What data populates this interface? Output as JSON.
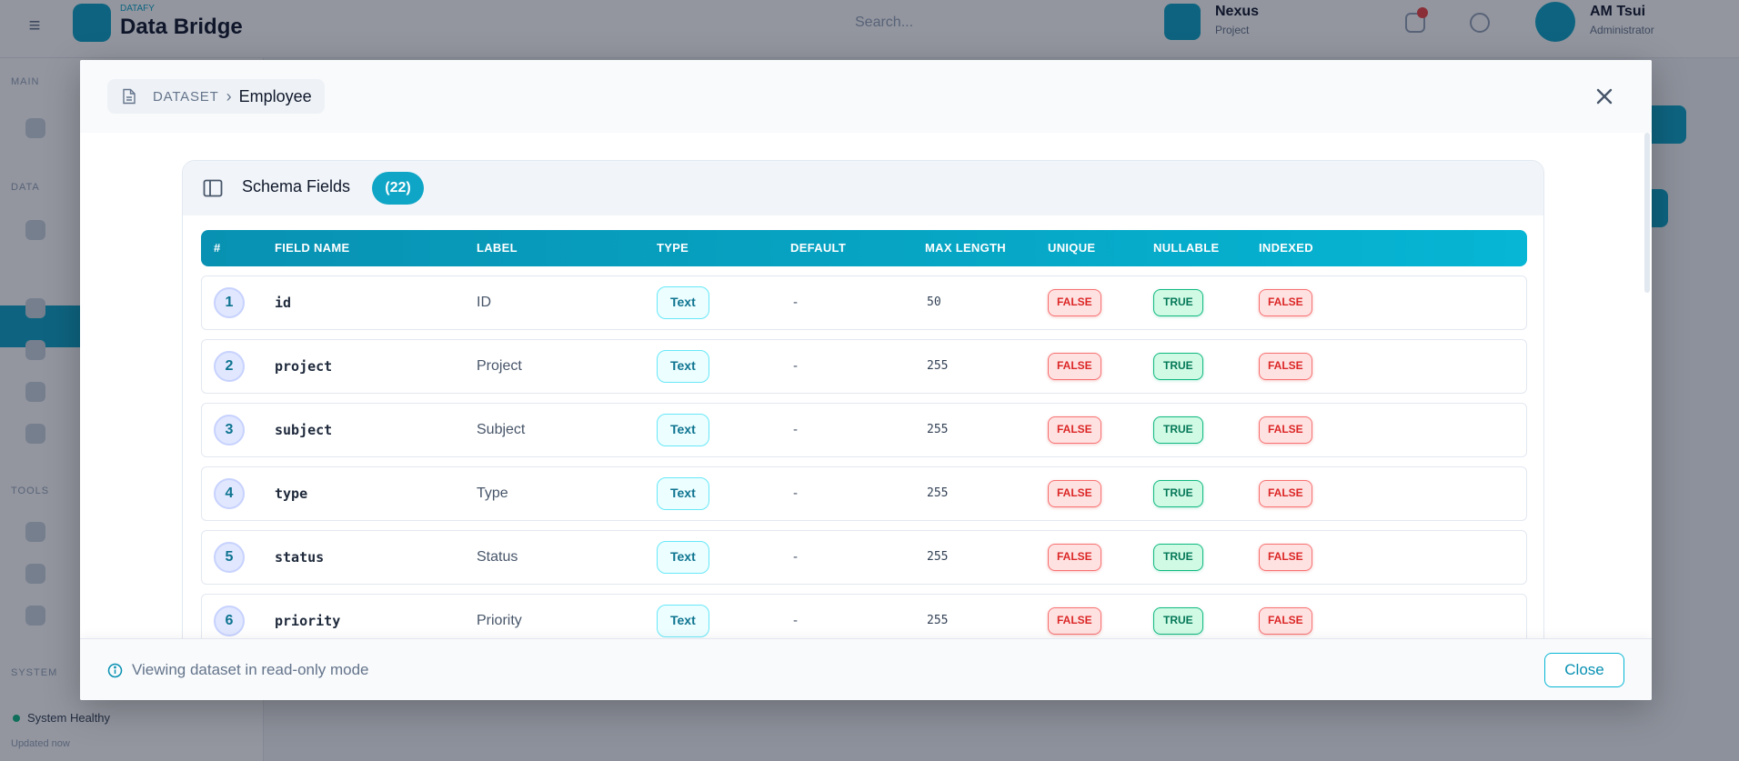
{
  "background": {
    "brand_sup": "DATAFY",
    "brand": "Data Bridge",
    "search_placeholder": "Search...",
    "workspace_name": "Nexus",
    "workspace_sub": "Project",
    "user_name": "AM Tsui",
    "user_role": "Administrator",
    "status_text": "System Healthy",
    "status_sub": "Updated now"
  },
  "modal": {
    "breadcrumb_root": "DATASET",
    "breadcrumb_separator": "›",
    "breadcrumb_current": "Employee",
    "card_title": "Schema Fields",
    "field_count": "(22)",
    "columns": [
      "#",
      "FIELD NAME",
      "LABEL",
      "TYPE",
      "DEFAULT",
      "MAX LENGTH",
      "UNIQUE",
      "NULLABLE",
      "INDEXED"
    ],
    "rows": [
      {
        "n": "1",
        "field": "id",
        "label": "ID",
        "type": "Text",
        "default": "-",
        "max": "50",
        "unique": "FALSE",
        "nullable": "TRUE",
        "indexed": "FALSE"
      },
      {
        "n": "2",
        "field": "project",
        "label": "Project",
        "type": "Text",
        "default": "-",
        "max": "255",
        "unique": "FALSE",
        "nullable": "TRUE",
        "indexed": "FALSE"
      },
      {
        "n": "3",
        "field": "subject",
        "label": "Subject",
        "type": "Text",
        "default": "-",
        "max": "255",
        "unique": "FALSE",
        "nullable": "TRUE",
        "indexed": "FALSE"
      },
      {
        "n": "4",
        "field": "type",
        "label": "Type",
        "type": "Text",
        "default": "-",
        "max": "255",
        "unique": "FALSE",
        "nullable": "TRUE",
        "indexed": "FALSE"
      },
      {
        "n": "5",
        "field": "status",
        "label": "Status",
        "type": "Text",
        "default": "-",
        "max": "255",
        "unique": "FALSE",
        "nullable": "TRUE",
        "indexed": "FALSE"
      },
      {
        "n": "6",
        "field": "priority",
        "label": "Priority",
        "type": "Text",
        "default": "-",
        "max": "255",
        "unique": "FALSE",
        "nullable": "TRUE",
        "indexed": "FALSE"
      }
    ],
    "footer_text": "Viewing dataset in read-only mode",
    "close_label": "Close",
    "close_icon": "close-icon"
  },
  "colors": {
    "accent": "#0ea5c6",
    "false_text": "#dc2626",
    "true_text": "#047857"
  }
}
